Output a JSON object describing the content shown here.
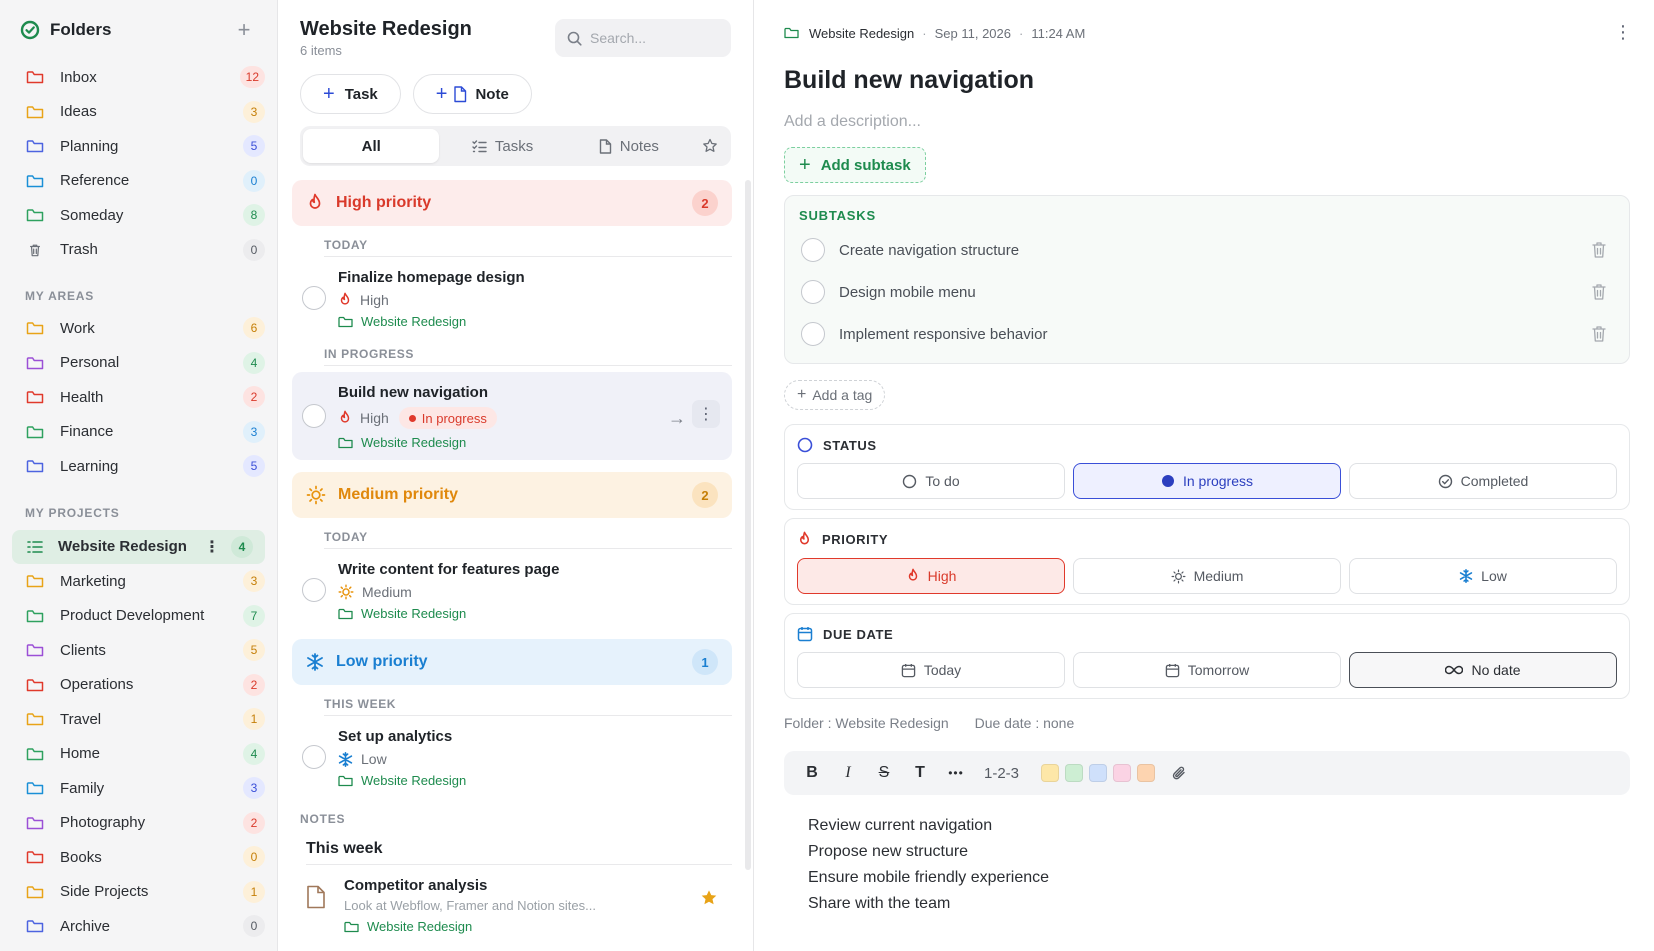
{
  "colors": {
    "accent_blue": "#2c4bd6",
    "green": "#1e8b4e",
    "red": "#e0392b",
    "orange": "#e8930c",
    "sky": "#1a7fd1"
  },
  "sidebar": {
    "title": "Folders",
    "folders": [
      {
        "label": "Inbox",
        "count": "12",
        "color": "#e0392b",
        "badge_bg": "#fde3e1",
        "badge_fg": "#d93a2b",
        "icon": "folder-icon"
      },
      {
        "label": "Ideas",
        "count": "3",
        "color": "#e8a317",
        "badge_bg": "#fdf0d9",
        "badge_fg": "#c57f08",
        "icon": "folder-icon"
      },
      {
        "label": "Planning",
        "count": "5",
        "color": "#4c63e0",
        "badge_bg": "#e4e8ff",
        "badge_fg": "#3a4fd8",
        "icon": "folder-icon"
      },
      {
        "label": "Reference",
        "count": "0",
        "color": "#1a8fd6",
        "badge_bg": "#e0f0fb",
        "badge_fg": "#1a7fd1",
        "icon": "folder-icon"
      },
      {
        "label": "Someday",
        "count": "8",
        "color": "#2ea15f",
        "badge_bg": "#dff3e6",
        "badge_fg": "#1e8b4e",
        "icon": "folder-icon"
      },
      {
        "label": "Trash",
        "count": "0",
        "color": "#6b7078",
        "badge_bg": "#ececee",
        "badge_fg": "#555a62",
        "icon": "trash-icon"
      }
    ],
    "areas_heading": "MY AREAS",
    "areas": [
      {
        "label": "Work",
        "count": "6",
        "color": "#e8a317",
        "badge_bg": "#fdf0d9",
        "badge_fg": "#c57f08"
      },
      {
        "label": "Personal",
        "count": "4",
        "color": "#9b4fd6",
        "badge_bg": "#dff3e6",
        "badge_fg": "#1e8b4e"
      },
      {
        "label": "Health",
        "count": "2",
        "color": "#e0392b",
        "badge_bg": "#fde3e1",
        "badge_fg": "#d93a2b"
      },
      {
        "label": "Finance",
        "count": "3",
        "color": "#2ea15f",
        "badge_bg": "#e0f0fb",
        "badge_fg": "#1a7fd1"
      },
      {
        "label": "Learning",
        "count": "5",
        "color": "#4c63e0",
        "badge_bg": "#e4e8ff",
        "badge_fg": "#3a4fd8"
      }
    ],
    "projects_heading": "MY PROJECTS",
    "active_project": {
      "label": "Website Redesign",
      "count": "4"
    },
    "projects": [
      {
        "label": "Marketing",
        "count": "3",
        "color": "#e8a317",
        "badge_bg": "#fdf0d9",
        "badge_fg": "#c57f08"
      },
      {
        "label": "Product Development",
        "count": "7",
        "color": "#2ea15f",
        "badge_bg": "#dff3e6",
        "badge_fg": "#1e8b4e"
      },
      {
        "label": "Clients",
        "count": "5",
        "color": "#9b4fd6",
        "badge_bg": "#fdf0d9",
        "badge_fg": "#c57f08"
      },
      {
        "label": "Operations",
        "count": "2",
        "color": "#e0392b",
        "badge_bg": "#fde3e1",
        "badge_fg": "#d93a2b"
      },
      {
        "label": "Travel",
        "count": "1",
        "color": "#e8a317",
        "badge_bg": "#fdf0d9",
        "badge_fg": "#c57f08"
      },
      {
        "label": "Home",
        "count": "4",
        "color": "#2ea15f",
        "badge_bg": "#dff3e6",
        "badge_fg": "#1e8b4e"
      },
      {
        "label": "Family",
        "count": "3",
        "color": "#1a8fd6",
        "badge_bg": "#e4e8ff",
        "badge_fg": "#3a4fd8"
      },
      {
        "label": "Photography",
        "count": "2",
        "color": "#9b4fd6",
        "badge_bg": "#fde3e1",
        "badge_fg": "#d93a2b"
      },
      {
        "label": "Books",
        "count": "0",
        "color": "#e0392b",
        "badge_bg": "#fdf0d9",
        "badge_fg": "#c57f08"
      },
      {
        "label": "Side Projects",
        "count": "1",
        "color": "#e8a317",
        "badge_bg": "#fdf0d9",
        "badge_fg": "#c57f08"
      },
      {
        "label": "Archive",
        "count": "0",
        "color": "#4c63e0",
        "badge_bg": "#ececee",
        "badge_fg": "#555a62"
      }
    ]
  },
  "list": {
    "title": "Website Redesign",
    "subtitle": "6 items",
    "search_placeholder": "Search...",
    "task_button": "Task",
    "note_button": "Note",
    "tabs": {
      "all": "All",
      "tasks": "Tasks",
      "notes": "Notes"
    },
    "high": {
      "label": "High priority",
      "count": "2"
    },
    "medium": {
      "label": "Medium priority",
      "count": "2"
    },
    "low": {
      "label": "Low priority",
      "count": "1"
    },
    "day_today": "TODAY",
    "day_in_progress": "IN PROGRESS",
    "day_this_week": "THIS WEEK",
    "tasks": [
      {
        "title": "Finalize homepage design",
        "priority": "High",
        "folder": "Website Redesign"
      },
      {
        "title": "Build new navigation",
        "priority": "High",
        "status": "In progress",
        "folder": "Website Redesign"
      },
      {
        "title": "Write content for features page",
        "priority": "Medium",
        "folder": "Website Redesign"
      },
      {
        "title": "Set up analytics",
        "priority": "Low",
        "folder": "Website Redesign"
      }
    ],
    "notes_heading": "NOTES",
    "notes_group": "This week",
    "note": {
      "title": "Competitor analysis",
      "preview": "Look at Webflow, Framer and Notion sites...",
      "folder": "Website Redesign"
    }
  },
  "detail": {
    "breadcrumb_folder": "Website Redesign",
    "breadcrumb_date": "Sep 11, 2026",
    "breadcrumb_time": "11:24 AM",
    "title": "Build new navigation",
    "description_placeholder": "Add a description...",
    "add_subtask": "Add subtask",
    "subtasks_heading": "SUBTASKS",
    "subtasks": [
      "Create navigation structure",
      "Design mobile menu",
      "Implement responsive behavior"
    ],
    "add_tag": "Add a tag",
    "status_heading": "STATUS",
    "status_options": {
      "todo": "To do",
      "in_progress": "In progress",
      "completed": "Completed"
    },
    "priority_heading": "PRIORITY",
    "priority_options": {
      "high": "High",
      "medium": "Medium",
      "low": "Low"
    },
    "due_heading": "DUE DATE",
    "due_options": {
      "today": "Today",
      "tomorrow": "Tomorrow",
      "none": "No date"
    },
    "meta_folder": "Folder : Website Redesign",
    "meta_due": "Due date : none",
    "toolbar": {
      "bold": "B",
      "italic": "I",
      "strike": "S",
      "text": "T",
      "more": "•••",
      "numbered": "1-2-3"
    },
    "swatches": [
      "#fde7a8",
      "#cdeed3",
      "#cfe0fb",
      "#fbd3e4",
      "#fdd4b0"
    ],
    "body_lines": [
      "Review current navigation",
      "Propose new structure",
      "Ensure mobile friendly experience",
      "Share with the team"
    ]
  }
}
